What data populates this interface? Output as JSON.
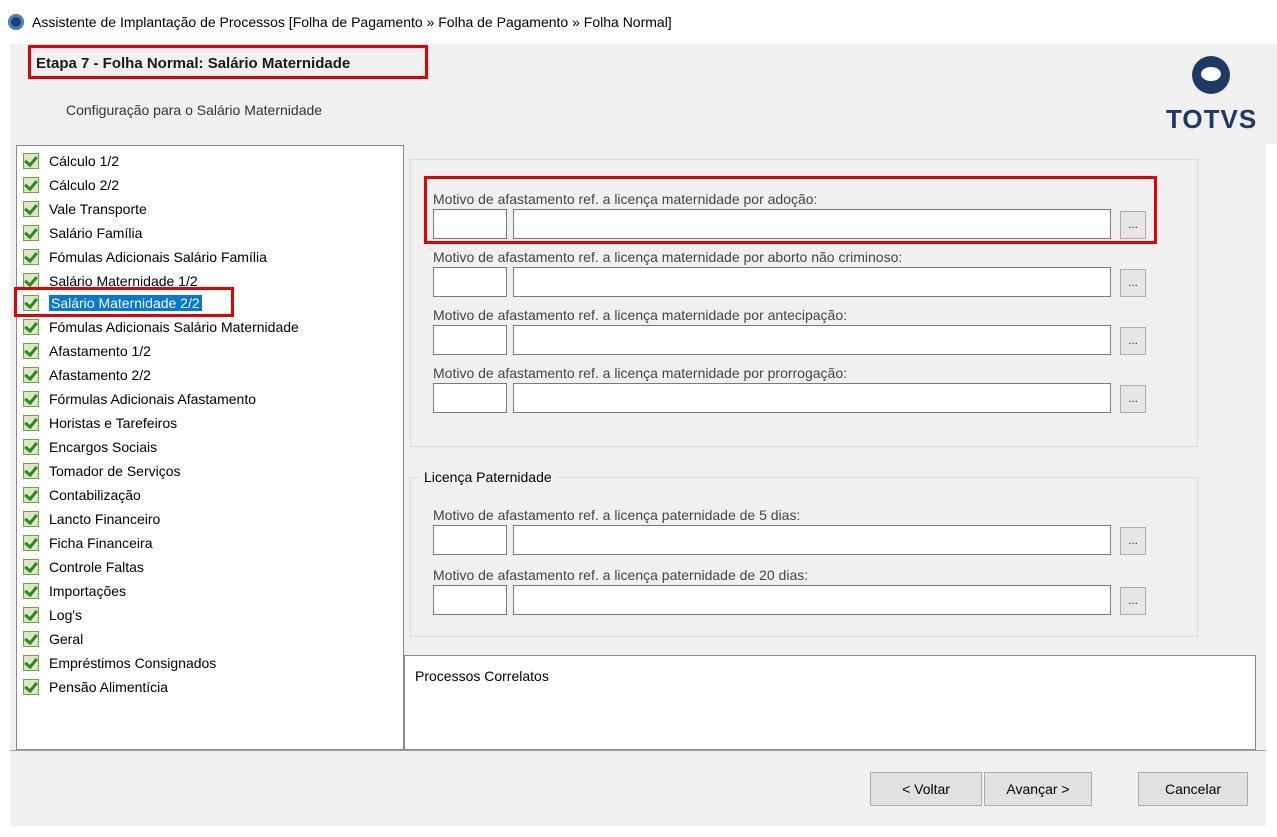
{
  "window": {
    "title": "Assistente de Implantação de Processos [Folha de Pagamento » Folha de Pagamento » Folha Normal]"
  },
  "header": {
    "step_title": "Etapa 7 - Folha Normal: Salário Maternidade",
    "subtitle": "Configuração para o Salário Maternidade",
    "logo_text": "TOTVS"
  },
  "tree": {
    "items": [
      {
        "label": "Cálculo 1/2"
      },
      {
        "label": "Cálculo 2/2"
      },
      {
        "label": "Vale Transporte"
      },
      {
        "label": "Salário Família"
      },
      {
        "label": "Fómulas Adicionais Salário Família"
      },
      {
        "label": "Salário Maternidade 1/2"
      },
      {
        "label": "Salário Maternidade 2/2",
        "selected": true
      },
      {
        "label": "Fómulas Adicionais Salário Maternidade"
      },
      {
        "label": "Afastamento 1/2"
      },
      {
        "label": "Afastamento 2/2"
      },
      {
        "label": "Fórmulas Adicionais Afastamento"
      },
      {
        "label": "Horistas e Tarefeiros"
      },
      {
        "label": "Encargos Sociais"
      },
      {
        "label": "Tomador de Serviços"
      },
      {
        "label": "Contabilização"
      },
      {
        "label": "Lancto Financeiro"
      },
      {
        "label": "Ficha Financeira"
      },
      {
        "label": "Controle Faltas"
      },
      {
        "label": "Importações"
      },
      {
        "label": "Log's"
      },
      {
        "label": "Geral"
      },
      {
        "label": "Empréstimos Consignados"
      },
      {
        "label": "Pensão Alimentícia"
      }
    ]
  },
  "maternity": {
    "fields": [
      {
        "label": "Motivo de afastamento ref. a licença maternidade por adoção:",
        "code": "",
        "description": ""
      },
      {
        "label": "Motivo de afastamento ref. a licença maternidade por aborto não criminoso:",
        "code": "",
        "description": ""
      },
      {
        "label": "Motivo de afastamento ref. a licença maternidade por antecipação:",
        "code": "",
        "description": ""
      },
      {
        "label": "Motivo de afastamento ref. a licença maternidade por prorrogação:",
        "code": "",
        "description": ""
      }
    ]
  },
  "paternity": {
    "legend": "Licença Paternidade",
    "fields": [
      {
        "label": "Motivo de afastamento ref. a licença  paternidade  de 5 dias:",
        "code": "",
        "description": ""
      },
      {
        "label": "Motivo de afastamento ref. a licença  paternidade  de 20 dias:",
        "code": "",
        "description": ""
      }
    ]
  },
  "lookup_label": "...",
  "related": {
    "label": "Processos Correlatos"
  },
  "buttons": {
    "back": "< Voltar",
    "next": "Avançar >",
    "cancel": "Cancelar"
  },
  "colors": {
    "highlight": "#e00000",
    "selection": "#0078d7",
    "brand": "#1e3a64"
  }
}
